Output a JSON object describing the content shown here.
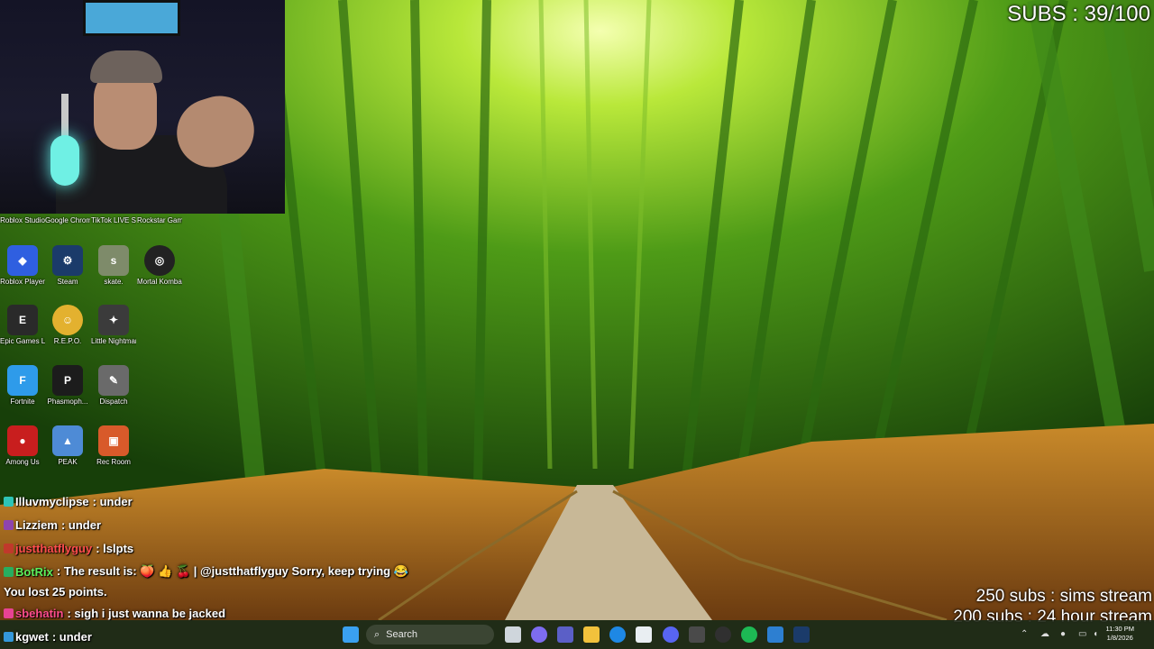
{
  "overlay": {
    "subs_counter": "SUBS : 39/100",
    "goals": [
      "250 subs : sims stream",
      "200 subs : 24 hour stream"
    ]
  },
  "desktop_icons": [
    {
      "label": "Roblox Studio",
      "icon": "roblox-studio-icon",
      "color": "#1b6fd6"
    },
    {
      "label": "Google Chrome",
      "icon": "chrome-icon",
      "color": "#e84336"
    },
    {
      "label": "TikTok LIVE Studio",
      "icon": "tiktok-icon",
      "color": "#111111"
    },
    {
      "label": "Rockstar Games ...",
      "icon": "rockstar-icon",
      "color": "#f1a81c"
    },
    {
      "label": "Roblox Player",
      "icon": "roblox-player-icon",
      "color": "#2f5fe0"
    },
    {
      "label": "Steam",
      "icon": "steam-icon",
      "color": "#1b3b6a"
    },
    {
      "label": "skate.",
      "icon": "skate-icon",
      "color": "#7e8b6a"
    },
    {
      "label": "Mortal Kombat X",
      "icon": "mortal-kombat-icon",
      "color": "#222222"
    },
    {
      "label": "Epic Games Launcher",
      "icon": "epic-games-icon",
      "color": "#2a2a2a"
    },
    {
      "label": "R.E.P.O.",
      "icon": "repo-icon",
      "color": "#e3b12f"
    },
    {
      "label": "Little Nightmar...",
      "icon": "little-nightmares-icon",
      "color": "#3b3b3b"
    },
    {
      "label": "Fortnite",
      "icon": "fortnite-icon",
      "color": "#2e9bea"
    },
    {
      "label": "Phasmoph...",
      "icon": "phasmophobia-icon",
      "color": "#1c1c1c"
    },
    {
      "label": "Dispatch",
      "icon": "dispatch-icon",
      "color": "#6a6a6a"
    },
    {
      "label": "Among Us",
      "icon": "among-us-icon",
      "color": "#c81e1e"
    },
    {
      "label": "PEAK",
      "icon": "peak-icon",
      "color": "#4e8bd6"
    },
    {
      "label": "Rec Room",
      "icon": "rec-room-icon",
      "color": "#d85a2a"
    }
  ],
  "chat": [
    {
      "user": "Illuvmyclipse",
      "message": ": under",
      "badge": "#2ec4b6",
      "user_color": "#ffffff"
    },
    {
      "user": "Lizziem",
      "message": ": under",
      "badge": "#8e44ad",
      "user_color": "#ffffff"
    },
    {
      "user": "justthatflyguy",
      "message": ": lslpts",
      "badge": "#c0392b",
      "user_color": "#ff4d4d"
    },
    {
      "user": "BotRix",
      "message": ": The result is: 🍑 👍 🍒 | @justthatflyguy Sorry, keep trying 😂",
      "badge": "#27ae60",
      "user_color": "#5bf05b"
    },
    {
      "user": "",
      "message": "You lost 25 points.",
      "badge": "",
      "user_color": "#ffffff"
    },
    {
      "user": "sbehatin",
      "message": ": sigh i just wanna be jacked",
      "badge": "#e84393",
      "user_color": "#ff4d8d"
    },
    {
      "user": "kgwet",
      "message": ": under",
      "badge": "#3498db",
      "user_color": "#ffffff"
    }
  ],
  "taskbar": {
    "search_placeholder": "Search",
    "apps": [
      "start-icon",
      "search-icon",
      "task-view-icon",
      "copilot-icon",
      "teams-icon",
      "file-explorer-icon",
      "edge-icon",
      "store-icon",
      "discord-icon",
      "app-icon",
      "obs-icon",
      "spotify-icon",
      "capture-icon",
      "steam-icon"
    ],
    "clock": {
      "time": "11:30 PM",
      "date": "1/8/2026"
    }
  }
}
